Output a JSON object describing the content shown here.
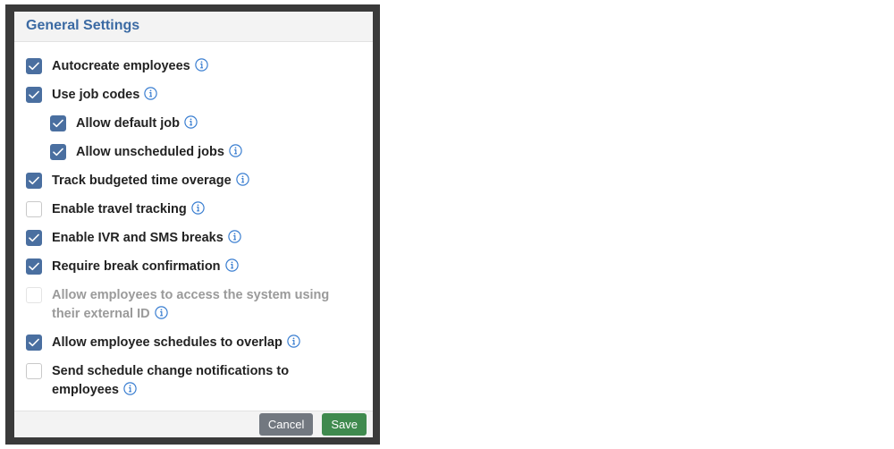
{
  "dialog": {
    "title": "General Settings",
    "cancel_label": "Cancel",
    "save_label": "Save"
  },
  "options": [
    {
      "label": "Autocreate employees",
      "checked": true,
      "disabled": false,
      "indent": false,
      "info": true
    },
    {
      "label": "Use job codes",
      "checked": true,
      "disabled": false,
      "indent": false,
      "info": true
    },
    {
      "label": "Allow default job",
      "checked": true,
      "disabled": false,
      "indent": true,
      "info": true
    },
    {
      "label": "Allow unscheduled jobs",
      "checked": true,
      "disabled": false,
      "indent": true,
      "info": true
    },
    {
      "label": "Track budgeted time overage",
      "checked": true,
      "disabled": false,
      "indent": false,
      "info": true
    },
    {
      "label": "Enable travel tracking",
      "checked": false,
      "disabled": false,
      "indent": false,
      "info": true
    },
    {
      "label": "Enable IVR and SMS breaks",
      "checked": true,
      "disabled": false,
      "indent": false,
      "info": true
    },
    {
      "label": "Require break confirmation",
      "checked": true,
      "disabled": false,
      "indent": false,
      "info": true
    },
    {
      "label": "Allow employees to access the system using their external ID",
      "checked": false,
      "disabled": true,
      "indent": false,
      "info": true
    },
    {
      "label": "Allow employee schedules to overlap",
      "checked": true,
      "disabled": false,
      "indent": false,
      "info": true
    },
    {
      "label": "Send schedule change notifications to employees",
      "checked": false,
      "disabled": false,
      "indent": false,
      "info": true
    }
  ],
  "icons": {
    "info": "info-circle-icon",
    "check": "checkmark-icon"
  },
  "colors": {
    "title": "#3b6aa3",
    "checkbox_checked": "#4a6fa0",
    "info_icon": "#3b7fd1",
    "cancel_button": "#727880",
    "save_button": "#3f8a4e"
  }
}
